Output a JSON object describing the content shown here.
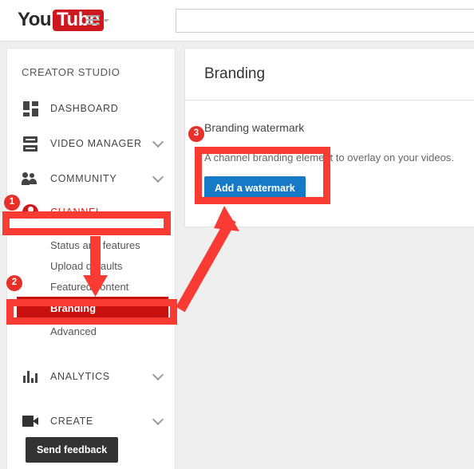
{
  "masthead": {
    "logo_you": "You",
    "logo_tube": "Tube",
    "guide_icon": "hamburger-menu-icon",
    "caret_icon": "chevron-down-icon",
    "search": {
      "value": "",
      "placeholder": ""
    }
  },
  "sidebar": {
    "title": "CREATOR STUDIO",
    "items": [
      {
        "label": "DASHBOARD",
        "icon": "dashboard-icon",
        "expandable": false
      },
      {
        "label": "VIDEO MANAGER",
        "icon": "video-manager-icon",
        "expandable": true
      },
      {
        "label": "COMMUNITY",
        "icon": "community-icon",
        "expandable": true
      },
      {
        "label": "CHANNEL",
        "icon": "channel-avatar-icon",
        "expandable": false
      },
      {
        "label": "ANALYTICS",
        "icon": "analytics-icon",
        "expandable": true
      },
      {
        "label": "CREATE",
        "icon": "create-icon",
        "expandable": true
      }
    ],
    "channel_subitems": [
      {
        "label": "Status and features"
      },
      {
        "label": "Upload defaults"
      },
      {
        "label": "Featured content"
      },
      {
        "label": "Branding"
      },
      {
        "label": "Advanced"
      }
    ],
    "feedback_label": "Send feedback"
  },
  "main": {
    "page_title": "Branding",
    "section_title": "Branding watermark",
    "section_desc": "A channel branding element to overlay on your videos.",
    "add_watermark_label": "Add a watermark"
  },
  "annotations": {
    "badges": [
      "1",
      "2",
      "3"
    ],
    "highlight_color": "#f93b33",
    "selected_item_color": "#c8110f",
    "accent_blue": "#167ac6",
    "brand_red": "#cc181e"
  }
}
